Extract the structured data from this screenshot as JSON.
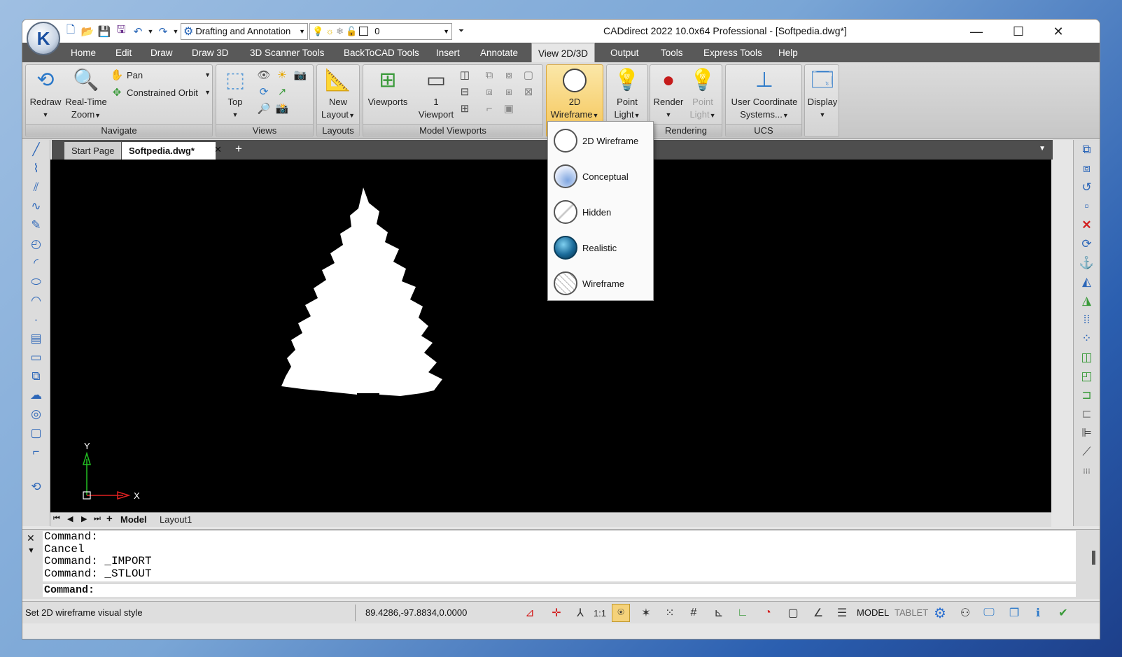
{
  "window": {
    "title": "CADdirect 2022 10.0x64 Professional  - [Softpedia.dwg*]",
    "workspace": "Drafting and Annotation",
    "layer": "0"
  },
  "menu": [
    "Home",
    "Edit",
    "Draw",
    "Draw 3D",
    "3D Scanner Tools",
    "BackToCAD Tools",
    "Insert",
    "Annotate",
    "View 2D/3D",
    "Output",
    "Tools",
    "Express Tools",
    "Help"
  ],
  "ribbon": {
    "navigate": {
      "label": "Navigate",
      "redraw": "Redraw",
      "realtime": "Real-Time",
      "zoom": "Zoom",
      "pan": "Pan",
      "orbit": "Constrained Orbit"
    },
    "views": {
      "label": "Views",
      "top": "Top"
    },
    "layouts": {
      "label": "Layouts",
      "new": "New",
      "layout": "Layout"
    },
    "model_viewports": {
      "label": "Model Viewports",
      "viewports": "Viewports",
      "one": "1",
      "viewport": "Viewport"
    },
    "visual_style": {
      "line1": "2D",
      "line2": "Wireframe"
    },
    "rendering": {
      "label": "Rendering",
      "point": "Point",
      "light": "Light",
      "render": "Render",
      "point2": "Point",
      "light2": "Light"
    },
    "ucs": {
      "label": "UCS",
      "line1": "User Coordinate",
      "line2": "Systems..."
    },
    "display": {
      "label": "Display"
    }
  },
  "doc_tabs": {
    "start": "Start Page",
    "active": "Softpedia.dwg*",
    "close": "✕",
    "add": "+"
  },
  "dropdown": [
    "2D Wireframe",
    "Conceptual",
    "Hidden",
    "Realistic",
    "Wireframe"
  ],
  "axes": {
    "y": "Y",
    "x": "X"
  },
  "layouts": {
    "model": "Model",
    "layout1": "Layout1"
  },
  "command": {
    "lines": [
      "Command:",
      "Cancel",
      "Command: _IMPORT",
      "Command: _STLOUT"
    ],
    "prompt": "Command:"
  },
  "status": {
    "message": "Set 2D wireframe visual style",
    "coords": "89.4286,-97.8834,0.0000",
    "scale": "1:1",
    "model": "MODEL",
    "tablet": "TABLET"
  },
  "colors": {
    "menubar": "#595959",
    "canvas": "#000000",
    "accent": "#1f5fb4"
  }
}
